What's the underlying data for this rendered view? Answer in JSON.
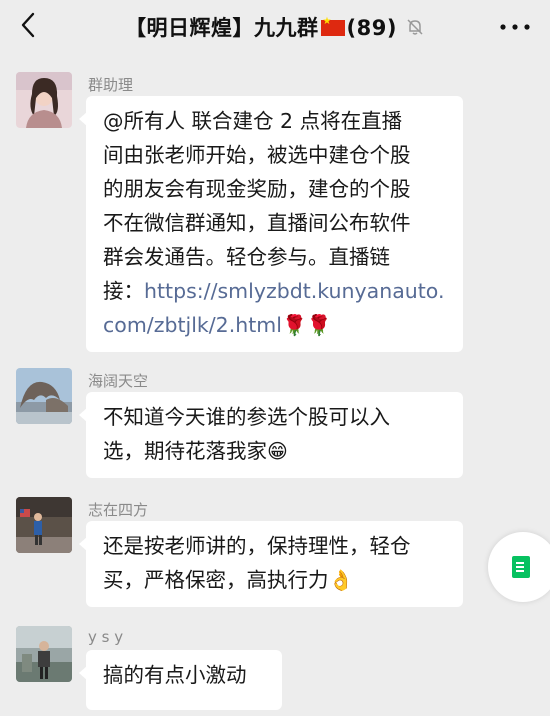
{
  "header": {
    "back_icon": "chevron-left-icon",
    "title_prefix": "【明日辉煌】九九群",
    "flag_icon": "china-flag-icon",
    "member_count": "(89)",
    "mute_icon": "bell-off-icon",
    "more_icon": "more-dots-icon"
  },
  "messages": [
    {
      "sender": "群助理",
      "lines": [
        "@所有人  联合建仓 2 点将在直播",
        "间由张老师开始，被选中建仓个股",
        "的朋友会有现金奖励，建仓的个股",
        "不在微信群通知，直播间公布软件",
        "群会发通告。轻仓参与。直播链"
      ],
      "link_prefix": "接：",
      "link_part1": "https://smlyzbdt.kunyanauto.",
      "link_part2": "com/zbtjlk/2.html",
      "emoji": "🌹🌹"
    },
    {
      "sender": "海阔天空",
      "line1": "不知道今天谁的参选个股可以入",
      "line2": "选，期待花落我家",
      "emoji": "😁"
    },
    {
      "sender": "志在四方",
      "line1": "还是按老师讲的，保持理性，轻仓",
      "line2": "买，严格保密，高执行力",
      "emoji": "👌"
    },
    {
      "sender": "y s y",
      "line1": "搞的有点小激动"
    }
  ],
  "colors": {
    "background": "#ededed",
    "bubble": "#ffffff",
    "link": "#576b95",
    "sender": "#8a8a8a",
    "accent": "#07c160"
  },
  "floating_button_icon": "document-icon"
}
